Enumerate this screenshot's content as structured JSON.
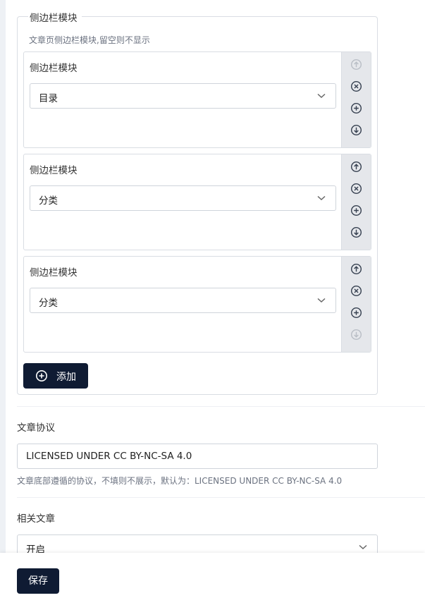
{
  "sidebar_modules": {
    "legend": "侧边栏模块",
    "hint": "文章页侧边栏模块,留空则不显示",
    "items": [
      {
        "label": "侧边栏模块",
        "value": "目录"
      },
      {
        "label": "侧边栏模块",
        "value": "分类"
      },
      {
        "label": "侧边栏模块",
        "value": "分类"
      }
    ],
    "add_label": "添加"
  },
  "license": {
    "label": "文章协议",
    "value": "LICENSED UNDER CC BY-NC-SA 4.0",
    "hint": "文章底部遵循的协议，不填则不展示，默认为：LICENSED UNDER CC BY-NC-SA 4.0"
  },
  "related": {
    "label": "相关文章",
    "value": "开启"
  },
  "footer": {
    "save_label": "保存"
  },
  "colors": {
    "primary": "#0f1b33",
    "control_bg": "#e5e7eb"
  }
}
